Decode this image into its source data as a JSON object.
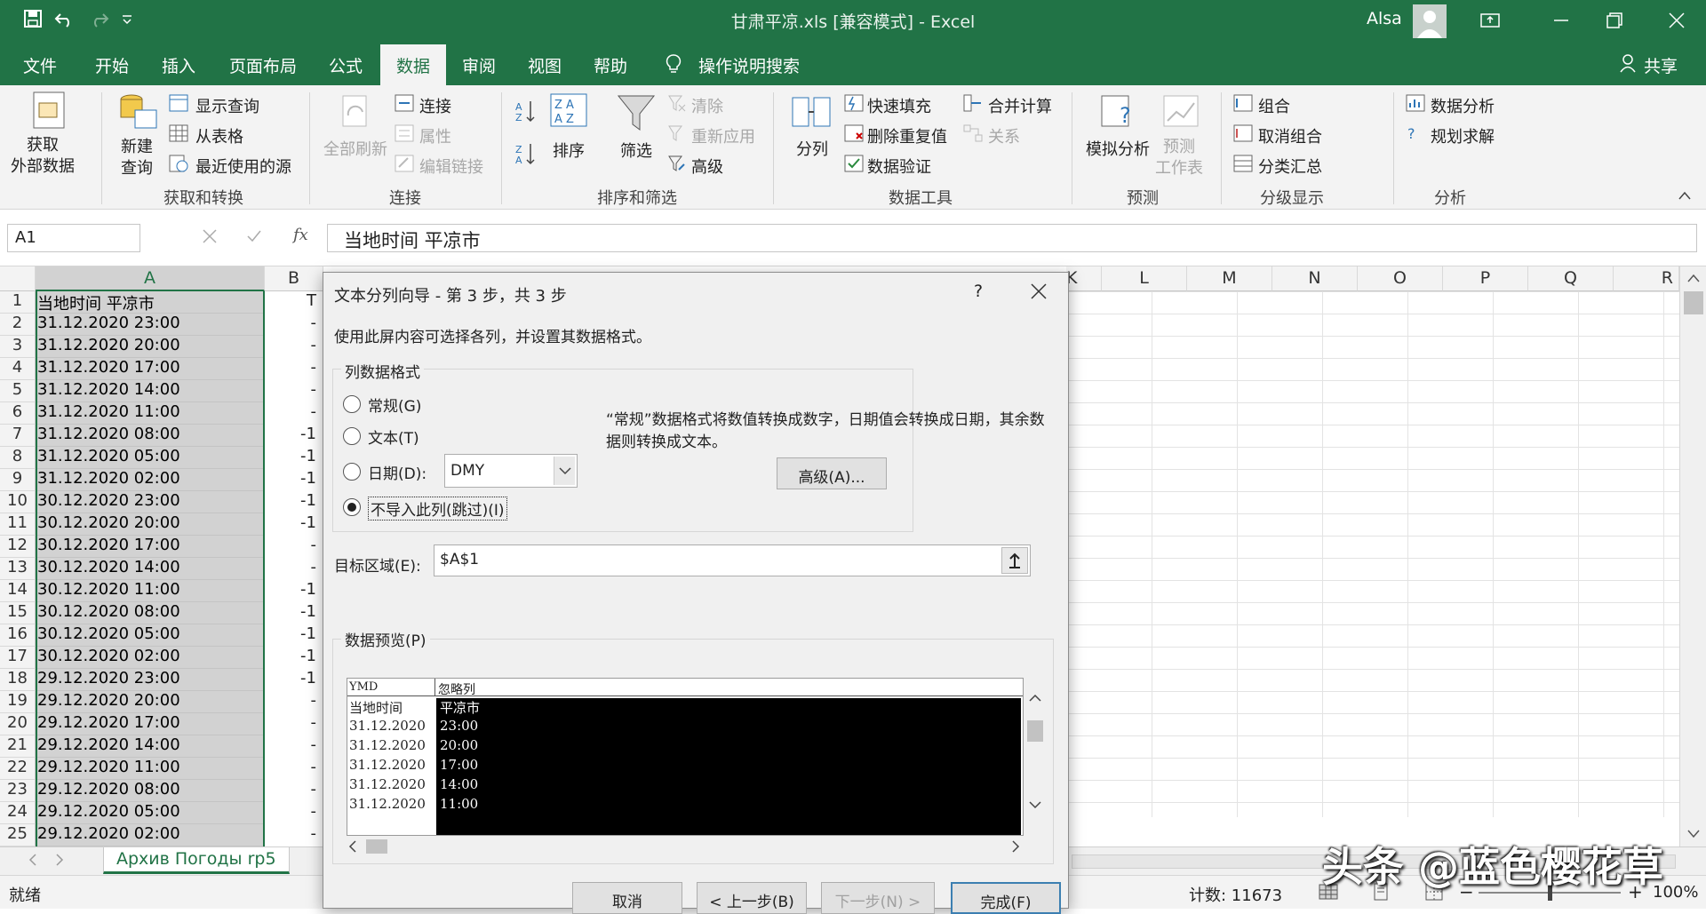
{
  "window": {
    "title": "甘肃平凉.xls  [兼容模式]  -  Excel",
    "user": "Alsa",
    "brand_color": "#217346"
  },
  "ribbon_tabs": [
    "文件",
    "开始",
    "插入",
    "页面布局",
    "公式",
    "数据",
    "审阅",
    "视图",
    "帮助",
    "操作说明搜索"
  ],
  "active_tab": "数据",
  "share_label": "共享",
  "ribbon": {
    "get_external": "获取\n外部数据",
    "new_query": "新建\n查询",
    "show_query": "显示查询",
    "from_table": "从表格",
    "recent_sources": "最近使用的源",
    "group_get_transform": "获取和转换",
    "refresh_all": "全部刷新",
    "connections": "连接",
    "properties": "属性",
    "edit_links": "编辑链接",
    "group_connections": "连接",
    "sort": "排序",
    "filter": "筛选",
    "clear": "清除",
    "reapply": "重新应用",
    "advanced": "高级",
    "group_sort_filter": "排序和筛选",
    "text_to_columns": "分列",
    "flash_fill": "快速填充",
    "remove_duplicates": "删除重复值",
    "data_validation": "数据验证",
    "consolidate": "合并计算",
    "relationships": "关系",
    "group_data_tools": "数据工具",
    "what_if": "模拟分析",
    "forecast_sheet": "预测\n工作表",
    "group_forecast": "预测",
    "group": "组合",
    "ungroup": "取消组合",
    "subtotal": "分类汇总",
    "group_outline": "分级显示",
    "data_analysis": "数据分析",
    "solver": "规划求解",
    "group_analysis": "分析"
  },
  "formula_bar": {
    "name_box": "A1",
    "fx": "fx",
    "content": "当地时间 平凉市"
  },
  "columns": [
    "A",
    "B",
    "K",
    "L",
    "M",
    "N",
    "O",
    "P",
    "Q",
    "R"
  ],
  "rows": [
    {
      "n": "1",
      "a": "当地时间 平凉市",
      "b": "T"
    },
    {
      "n": "2",
      "a": "31.12.2020 23:00",
      "b": "-"
    },
    {
      "n": "3",
      "a": "31.12.2020 20:00",
      "b": "-"
    },
    {
      "n": "4",
      "a": "31.12.2020 17:00",
      "b": "-"
    },
    {
      "n": "5",
      "a": "31.12.2020 14:00",
      "b": "-"
    },
    {
      "n": "6",
      "a": "31.12.2020 11:00",
      "b": "-"
    },
    {
      "n": "7",
      "a": "31.12.2020 08:00",
      "b": "-1"
    },
    {
      "n": "8",
      "a": "31.12.2020 05:00",
      "b": "-1"
    },
    {
      "n": "9",
      "a": "31.12.2020 02:00",
      "b": "-1"
    },
    {
      "n": "10",
      "a": "30.12.2020 23:00",
      "b": "-1"
    },
    {
      "n": "11",
      "a": "30.12.2020 20:00",
      "b": "-1"
    },
    {
      "n": "12",
      "a": "30.12.2020 17:00",
      "b": "-"
    },
    {
      "n": "13",
      "a": "30.12.2020 14:00",
      "b": "-"
    },
    {
      "n": "14",
      "a": "30.12.2020 11:00",
      "b": "-1"
    },
    {
      "n": "15",
      "a": "30.12.2020 08:00",
      "b": "-1"
    },
    {
      "n": "16",
      "a": "30.12.2020 05:00",
      "b": "-1"
    },
    {
      "n": "17",
      "a": "30.12.2020 02:00",
      "b": "-1"
    },
    {
      "n": "18",
      "a": "29.12.2020 23:00",
      "b": "-1"
    },
    {
      "n": "19",
      "a": "29.12.2020 20:00",
      "b": "-"
    },
    {
      "n": "20",
      "a": "29.12.2020 17:00",
      "b": "-"
    },
    {
      "n": "21",
      "a": "29.12.2020 14:00",
      "b": "-"
    },
    {
      "n": "22",
      "a": "29.12.2020 11:00",
      "b": "-"
    },
    {
      "n": "23",
      "a": "29.12.2020 08:00",
      "b": "-"
    },
    {
      "n": "24",
      "a": "29.12.2020 05:00",
      "b": "-"
    },
    {
      "n": "25",
      "a": "29.12.2020 02:00",
      "b": "-"
    }
  ],
  "sheet_tab": "Архив Погоды rp5",
  "status": {
    "ready": "就绪",
    "count": "计数: 11673",
    "zoom": "100%"
  },
  "dialog": {
    "title": "文本分列向导 - 第 3 步，共 3 步",
    "help": "?",
    "instruction": "使用此屏内容可选择各列，并设置其数据格式。",
    "format_group": "列数据格式",
    "opt_general": "常规(G)",
    "opt_text": "文本(T)",
    "opt_date": "日期(D):",
    "date_value": "DMY",
    "opt_skip": "不导入此列(跳过)(I)",
    "selected_option": "skip",
    "description": "“常规”数据格式将数值转换成数字，日期值会转换成日期，其余数据则转换成文本。",
    "advanced_btn": "高级(A)...",
    "dest_label": "目标区域(E):",
    "dest_value": "$A$1",
    "preview_label": "数据预览(P)",
    "preview_headers": [
      "YMD",
      "忽略列"
    ],
    "preview_col1": [
      "当地时间",
      "31.12.2020",
      "31.12.2020",
      "31.12.2020",
      "31.12.2020",
      "31.12.2020"
    ],
    "preview_col2": [
      "平凉市",
      "23:00",
      "20:00",
      "17:00",
      "14:00",
      "11:00"
    ],
    "cancel": "取消",
    "back": "< 上一步(B)",
    "next": "下一步(N) >",
    "finish": "完成(F)"
  },
  "watermark": "头条 @蓝色樱花草"
}
